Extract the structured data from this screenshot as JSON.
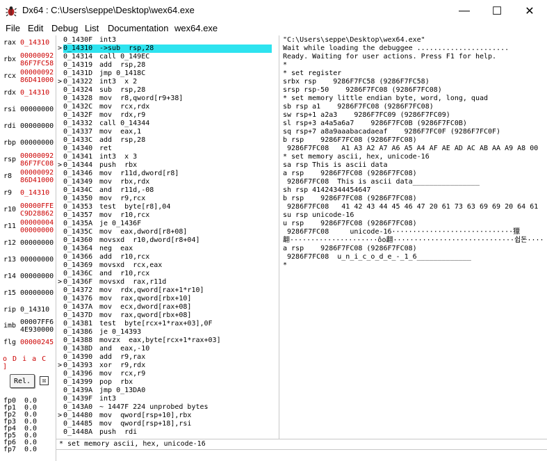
{
  "window": {
    "title": "Dx64 : C:\\Users\\seppe\\Desktop\\wex64.exe",
    "min_glyph": "—",
    "max_glyph": "☐",
    "close_glyph": "✕"
  },
  "menu": [
    "File",
    "Edit",
    "Debug",
    "List",
    "Documentation",
    "wex64.exe"
  ],
  "registers": [
    {
      "name": "rax",
      "lines": [
        "0_14310"
      ],
      "red": true
    },
    {
      "name": "rbx",
      "lines": [
        "00000092",
        "86F7FC58"
      ],
      "red": true
    },
    {
      "name": "rcx",
      "lines": [
        "00000092",
        "86D41000"
      ],
      "red": true
    },
    {
      "name": "rdx",
      "lines": [
        "0_14310"
      ],
      "red": true
    },
    {
      "name": "rsi",
      "lines": [
        "00000000"
      ],
      "red": false
    },
    {
      "name": "rdi",
      "lines": [
        "00000000"
      ],
      "red": false
    },
    {
      "name": "rbp",
      "lines": [
        "00000000"
      ],
      "red": false
    },
    {
      "name": "rsp",
      "lines": [
        "00000092",
        "86F7FC08"
      ],
      "red": true
    },
    {
      "name": "r8",
      "lines": [
        "00000092",
        "86D41000"
      ],
      "red": true
    },
    {
      "name": "r9",
      "lines": [
        "0_14310"
      ],
      "red": true
    },
    {
      "name": "r10",
      "lines": [
        "00000FFE",
        "C9D28862"
      ],
      "red": true
    },
    {
      "name": "r11",
      "lines": [
        "00000004",
        "00000000"
      ],
      "red": true
    },
    {
      "name": "r12",
      "lines": [
        "00000000"
      ],
      "red": false
    },
    {
      "name": "r13",
      "lines": [
        "00000000"
      ],
      "red": false
    },
    {
      "name": "r14",
      "lines": [
        "00000000"
      ],
      "red": false
    },
    {
      "name": "r15",
      "lines": [
        "00000000"
      ],
      "red": false
    },
    {
      "name": "rip",
      "lines": [
        "0_14310"
      ],
      "red": false
    },
    {
      "name": "imb",
      "lines": [
        "00007FF6",
        "4E930000"
      ],
      "red": false
    },
    {
      "name": "flg",
      "lines": [
        "00000245"
      ],
      "red": true
    }
  ],
  "flags_text": "o D i a C ]",
  "rel_label": "Rel.",
  "rel_check_glyph": "☒",
  "fpu": [
    {
      "name": "fp0",
      "value": "0.0"
    },
    {
      "name": "fp1",
      "value": "0.0"
    },
    {
      "name": "fp2",
      "value": "0.0"
    },
    {
      "name": "fp3",
      "value": "0.0"
    },
    {
      "name": "fp4",
      "value": "0.0"
    },
    {
      "name": "fp5",
      "value": "0.0"
    },
    {
      "name": "fp6",
      "value": "0.0"
    },
    {
      "name": "fp7",
      "value": "0.0"
    }
  ],
  "disasm": [
    {
      "mark": "",
      "addr": "0_1430F",
      "instr": "int3"
    },
    {
      "mark": ">",
      "addr": "0_14310",
      "instr": "->sub  rsp,28",
      "hl": true
    },
    {
      "mark": "",
      "addr": "0_14314",
      "instr": "call 0_149EC"
    },
    {
      "mark": "",
      "addr": "0_14319",
      "instr": "add  rsp,28"
    },
    {
      "mark": "",
      "addr": "0_1431D",
      "instr": "jmp 0_1418C"
    },
    {
      "mark": ">",
      "addr": "0_14322",
      "instr": "int3  x 2"
    },
    {
      "mark": "",
      "addr": "0_14324",
      "instr": "sub  rsp,28"
    },
    {
      "mark": "",
      "addr": "0_14328",
      "instr": "mov  r8,qword[r9+38]"
    },
    {
      "mark": "",
      "addr": "0_1432C",
      "instr": "mov  rcx,rdx"
    },
    {
      "mark": "",
      "addr": "0_1432F",
      "instr": "mov  rdx,r9"
    },
    {
      "mark": "",
      "addr": "0_14332",
      "instr": "call 0_14344"
    },
    {
      "mark": "",
      "addr": "0_14337",
      "instr": "mov  eax,1"
    },
    {
      "mark": "",
      "addr": "0_1433C",
      "instr": "add  rsp,28"
    },
    {
      "mark": "",
      "addr": "0_14340",
      "instr": "ret"
    },
    {
      "mark": "",
      "addr": "0_14341",
      "instr": "int3  x 3"
    },
    {
      "mark": ">",
      "addr": "0_14344",
      "instr": "push  rbx"
    },
    {
      "mark": "",
      "addr": "0_14346",
      "instr": "mov  r11d,dword[r8]"
    },
    {
      "mark": "",
      "addr": "0_14349",
      "instr": "mov  rbx,rdx"
    },
    {
      "mark": "",
      "addr": "0_1434C",
      "instr": "and  r11d,-08"
    },
    {
      "mark": "",
      "addr": "0_14350",
      "instr": "mov  r9,rcx"
    },
    {
      "mark": "",
      "addr": "0_14353",
      "instr": "test  byte[r8],04"
    },
    {
      "mark": "",
      "addr": "0_14357",
      "instr": "mov  r10,rcx"
    },
    {
      "mark": "",
      "addr": "0_1435A",
      "instr": "je 0_1436F"
    },
    {
      "mark": "",
      "addr": "0_1435C",
      "instr": "mov  eax,dword[r8+08]"
    },
    {
      "mark": "",
      "addr": "0_14360",
      "instr": "movsxd  r10,dword[r8+04]"
    },
    {
      "mark": "",
      "addr": "0_14364",
      "instr": "neg  eax"
    },
    {
      "mark": "",
      "addr": "0_14366",
      "instr": "add  r10,rcx"
    },
    {
      "mark": "",
      "addr": "0_14369",
      "instr": "movsxd  rcx,eax"
    },
    {
      "mark": "",
      "addr": "0_1436C",
      "instr": "and  r10,rcx"
    },
    {
      "mark": ">",
      "addr": "0_1436F",
      "instr": "movsxd  rax,r11d"
    },
    {
      "mark": "",
      "addr": "0_14372",
      "instr": "mov  rdx,qword[rax+1*r10]"
    },
    {
      "mark": "",
      "addr": "0_14376",
      "instr": "mov  rax,qword[rbx+10]"
    },
    {
      "mark": "",
      "addr": "0_1437A",
      "instr": "mov  ecx,dword[rax+08]"
    },
    {
      "mark": "",
      "addr": "0_1437D",
      "instr": "mov  rax,qword[rbx+08]"
    },
    {
      "mark": "",
      "addr": "0_14381",
      "instr": "test  byte[rcx+1*rax+03],0F"
    },
    {
      "mark": "",
      "addr": "0_14386",
      "instr": "je 0_14393"
    },
    {
      "mark": "",
      "addr": "0_14388",
      "instr": "movzx  eax,byte[rcx+1*rax+03]"
    },
    {
      "mark": "",
      "addr": "0_1438D",
      "instr": "and  eax,-10"
    },
    {
      "mark": "",
      "addr": "0_14390",
      "instr": "add  r9,rax"
    },
    {
      "mark": ">",
      "addr": "0_14393",
      "instr": "xor  r9,rdx"
    },
    {
      "mark": "",
      "addr": "0_14396",
      "instr": "mov  rcx,r9"
    },
    {
      "mark": "",
      "addr": "0_14399",
      "instr": "pop  rbx"
    },
    {
      "mark": "",
      "addr": "0_1439A",
      "instr": "jmp 0_13DA0"
    },
    {
      "mark": "",
      "addr": "0_1439F",
      "instr": "int3"
    },
    {
      "mark": "",
      "addr": "0_143A0",
      "instr": "~ 1447F 224 unprobed bytes"
    },
    {
      "mark": ">",
      "addr": "0_14480",
      "instr": "mov  qword[rsp+10],rbx"
    },
    {
      "mark": "",
      "addr": "0_14485",
      "instr": "mov  qword[rsp+18],rsi"
    },
    {
      "mark": "",
      "addr": "0_1448A",
      "instr": "push  rdi"
    }
  ],
  "console": [
    {
      "text": "\"C:\\Users\\seppe\\Desktop\\wex64.exe\""
    },
    {
      "text": "Wait while loading the debuggee ......................"
    },
    {
      "text": "Ready. Waiting for user actions. Press F1 for help."
    },
    {
      "text": "*"
    },
    {
      "text": "* set register"
    },
    {
      "text": "srbx rsp    9286F7FC58 (9286F7FC58)"
    },
    {
      "text": "srsp rsp-50    9286F7FC08 (9286F7FC08)"
    },
    {
      "text": "* set memory little endian byte, word, long, quad"
    },
    {
      "text": "sb rsp a1    9286F7FC08 (9286F7FC08)"
    },
    {
      "text": "sw rsp+1 a2a3    9286F7FC09 (9286F7FC09)"
    },
    {
      "text": "sl rsp+3 a4a5a6a7    9286F7FC0B (9286F7FC0B)"
    },
    {
      "text": "sq rsp+7 a8a9aaabacadaeaf    9286F7FC0F (9286F7FC0F)"
    },
    {
      "text": "b rsp    9286F7FC08 (9286F7FC08)"
    },
    {
      "text": " 9286F7FC08   A1 A3 A2 A7 A6 A5 A4 AF AE AD AC AB AA A9 A8 00"
    },
    {
      "text": "* set memory ascii, hex, unicode-16"
    },
    {
      "text": "sa rsp This is ascii data"
    },
    {
      "text": "a rsp    9286F7FC08 (9286F7FC08)"
    },
    {
      "text": " 9286F7FC08  This is ascii data________________"
    },
    {
      "text": "sh rsp 41424344454647"
    },
    {
      "text": "b rsp    9286F7FC08 (9286F7FC08)"
    },
    {
      "text": " 9286F7FC08   41 42 43 44 45 46 47 20 61 73 63 69 69 20 64 61"
    },
    {
      "text": "su rsp unicode-16"
    },
    {
      "text": "u rsp    9286F7FC08 (9286F7FC08)"
    },
    {
      "text": " 9286F7FC08     unicode-16·····························獵"
    },
    {
      "text": "翿·····················ôo翿·····························쉽돈····"
    },
    {
      "text": "a rsp    9286F7FC08 (9286F7FC08)"
    },
    {
      "text": " 9286F7FC08  u_n_i_c_o_d_e_-_1_6_____________"
    },
    {
      "text": "*"
    }
  ],
  "cmd_history": "* set memory ascii, hex, unicode-16",
  "cmd_input_value": "",
  "colors": {
    "highlight": "#2ee3ef",
    "reg_changed": "#cc0000"
  }
}
